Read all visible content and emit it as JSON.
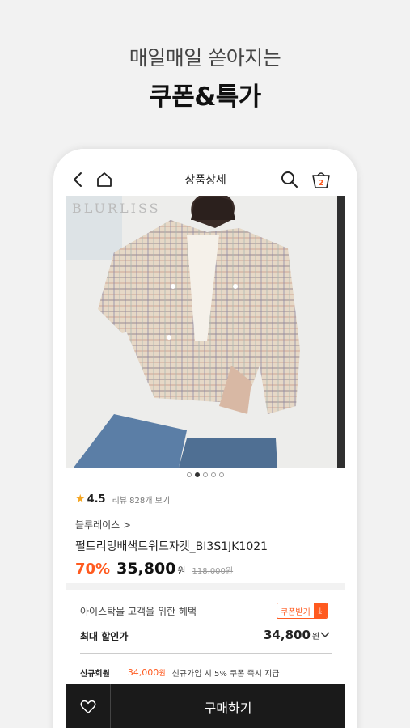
{
  "promo": {
    "subtitle": "매일매일 쏟아지는",
    "title": "쿠폰&특가"
  },
  "header": {
    "title": "상품상세",
    "cart_count": "2",
    "icons": [
      "back-icon",
      "home-icon",
      "search-icon",
      "cart-icon"
    ]
  },
  "product": {
    "image_brand_mark": "BLURLISS",
    "rating": "4.5",
    "reviews_label": "리뷰 828개 보기",
    "brand": "블루레이스 >",
    "name": "펄트리밍배색트위드자켓_BI3S1JK1021",
    "discount": "70%",
    "price": "35,800",
    "price_unit": "원",
    "original_price": "118,000원",
    "carousel": {
      "total": 5,
      "active_index": 1
    }
  },
  "benefits": {
    "title": "아이스탁몰 고객을 위한 혜택",
    "coupon_button": "쿠폰받기",
    "max_discount_label": "최대 할인가",
    "max_discount_value": "34,800",
    "max_discount_unit": "원",
    "new_member_label": "신규회원",
    "new_member_value": "34,000",
    "new_member_unit": "원",
    "new_member_desc": "신규가입 시 5% 쿠폰 즉시 지급"
  },
  "bottom": {
    "buy_label": "구매하기"
  },
  "colors": {
    "accent": "#ff5a1f",
    "star": "#f5a623",
    "bottom_bar": "#1a1a1a"
  }
}
